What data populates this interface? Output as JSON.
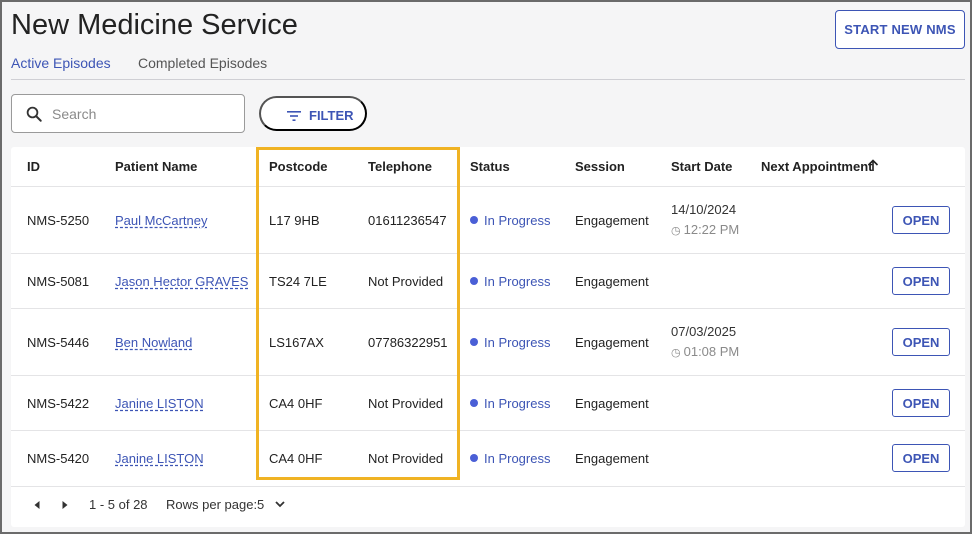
{
  "header": {
    "title": "New Medicine Service",
    "start_button": "START NEW NMS"
  },
  "tabs": [
    {
      "label": "Active Episodes",
      "active": true
    },
    {
      "label": "Completed Episodes",
      "active": false
    }
  ],
  "search": {
    "placeholder": "Search",
    "value": ""
  },
  "filter": {
    "label": "FILTER"
  },
  "table": {
    "columns": [
      "ID",
      "Patient Name",
      "Postcode",
      "Telephone",
      "Status",
      "Session",
      "Start Date",
      "Next Appointment"
    ],
    "sort": {
      "column": "Next Appointment",
      "direction": "ascending"
    },
    "open_label": "OPEN",
    "rows": [
      {
        "id": "NMS-5250",
        "patient": "Paul McCartney",
        "postcode": "L17 9HB",
        "telephone": "01611236547",
        "status": "In Progress",
        "session": "Engagement",
        "start_date": "14/10/2024",
        "start_time": "12:22 PM"
      },
      {
        "id": "NMS-5081",
        "patient": "Jason Hector GRAVES",
        "postcode": "TS24 7LE",
        "telephone": "Not Provided",
        "status": "In Progress",
        "session": "Engagement",
        "start_date": "",
        "start_time": ""
      },
      {
        "id": "NMS-5446",
        "patient": "Ben Nowland",
        "postcode": "LS167AX",
        "telephone": "07786322951",
        "status": "In Progress",
        "session": "Engagement",
        "start_date": "07/03/2025",
        "start_time": "01:08 PM"
      },
      {
        "id": "NMS-5422",
        "patient": "Janine LISTON",
        "postcode": "CA4 0HF",
        "telephone": "Not Provided",
        "status": "In Progress",
        "session": "Engagement",
        "start_date": "",
        "start_time": ""
      },
      {
        "id": "NMS-5420",
        "patient": "Janine LISTON",
        "postcode": "CA4 0HF",
        "telephone": "Not Provided",
        "status": "In Progress",
        "session": "Engagement",
        "start_date": "",
        "start_time": ""
      }
    ]
  },
  "pagination": {
    "range": "1 - 5 of 28",
    "rows_per_page_label": "Rows per page:",
    "rows_per_page": "5"
  },
  "colors": {
    "accent": "#3d55b5",
    "status_dot": "#4a5fd6",
    "highlight": "#f0b323"
  },
  "icons": [
    "search-icon",
    "filter-icon",
    "sort-arrow-up-icon",
    "status-dot-icon",
    "clock-icon",
    "chevron-left-icon",
    "chevron-right-icon",
    "chevron-down-icon"
  ]
}
